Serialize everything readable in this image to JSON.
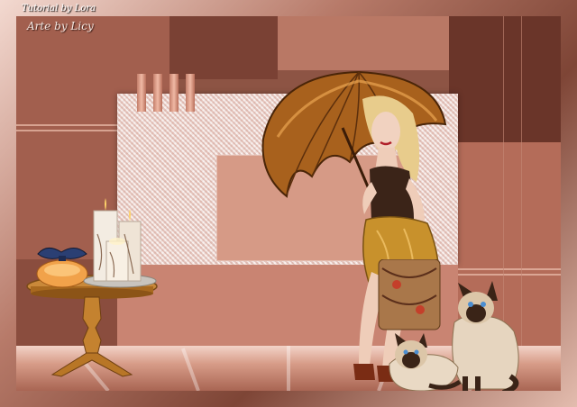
{
  "watermark": {
    "text": "Tutorial by Lora"
  },
  "signature": {
    "text": "Arte by Licy"
  },
  "colors": {
    "frame_light": "#f3d9d0",
    "frame_dark": "#7e4536",
    "background": "#8d5444",
    "panel_mid": "#b06a57",
    "panel_dark": "#6f3a2e",
    "texture": "#e9cfc8",
    "floor": "#d79c88",
    "umbrella": "#a8611d",
    "dress_gold": "#c8912c"
  },
  "scene": {
    "elements": [
      "umbrella",
      "woman",
      "siamese-cat-sitting",
      "siamese-cat-lying",
      "side-table",
      "candles",
      "perfume-bottle",
      "pillars"
    ]
  }
}
